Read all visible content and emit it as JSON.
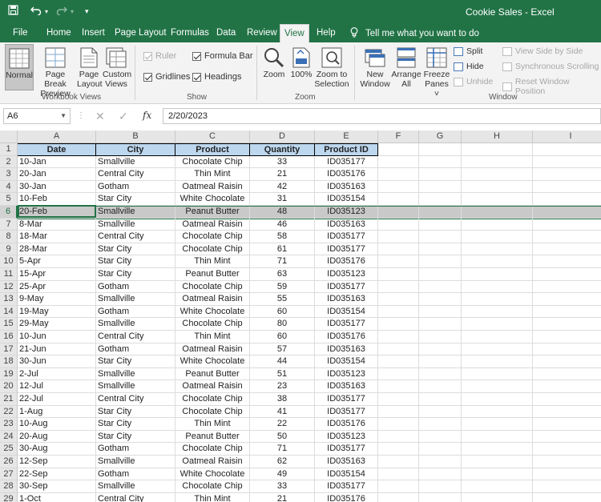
{
  "window": {
    "title": "Cookie Sales  -  Excel"
  },
  "tabs": [
    "File",
    "Home",
    "Insert",
    "Page Layout",
    "Formulas",
    "Data",
    "Review",
    "View",
    "Help"
  ],
  "active_tab": "View",
  "tell_me": "Tell me what you want to do",
  "ribbon": {
    "workbook_views": {
      "label": "Workbook Views",
      "normal": "Normal",
      "page_break_1": "Page Break",
      "page_break_2": "Preview",
      "page_layout_1": "Page",
      "page_layout_2": "Layout",
      "custom_1": "Custom",
      "custom_2": "Views"
    },
    "show": {
      "label": "Show",
      "ruler": "Ruler",
      "formula_bar": "Formula Bar",
      "gridlines": "Gridlines",
      "headings": "Headings"
    },
    "zoom": {
      "label": "Zoom",
      "zoom": "Zoom",
      "hundred": "100%",
      "zoom_sel_1": "Zoom to",
      "zoom_sel_2": "Selection"
    },
    "window": {
      "label": "Window",
      "new_1": "New",
      "new_2": "Window",
      "arrange_1": "Arrange",
      "arrange_2": "All",
      "freeze_1": "Freeze",
      "freeze_2": "Panes ˅",
      "split": "Split",
      "hide": "Hide",
      "unhide": "Unhide",
      "side_by_side": "View Side by Side",
      "sync_scroll": "Synchronous Scrolling",
      "reset_pos": "Reset Window Position"
    }
  },
  "formula_bar": {
    "name_box": "A6",
    "fx": "fx",
    "value": "2/20/2023"
  },
  "columns": [
    "A",
    "B",
    "C",
    "D",
    "E",
    "F",
    "G",
    "H",
    "I"
  ],
  "headers": [
    "Date",
    "City",
    "Product",
    "Quantity",
    "Product ID"
  ],
  "rows": [
    [
      "10-Jan",
      "Smallville",
      "Chocolate Chip",
      "33",
      "ID035177"
    ],
    [
      "20-Jan",
      "Central City",
      "Thin Mint",
      "21",
      "ID035176"
    ],
    [
      "30-Jan",
      "Gotham",
      "Oatmeal Raisin",
      "42",
      "ID035163"
    ],
    [
      "10-Feb",
      "Star City",
      "White Chocolate",
      "31",
      "ID035154"
    ],
    [
      "20-Feb",
      "Smallville",
      "Peanut Butter",
      "48",
      "ID035123"
    ],
    [
      "8-Mar",
      "Smallville",
      "Oatmeal Raisin",
      "46",
      "ID035163"
    ],
    [
      "18-Mar",
      "Central City",
      "Chocolate Chip",
      "58",
      "ID035177"
    ],
    [
      "28-Mar",
      "Star City",
      "Chocolate Chip",
      "61",
      "ID035177"
    ],
    [
      "5-Apr",
      "Star City",
      "Thin Mint",
      "71",
      "ID035176"
    ],
    [
      "15-Apr",
      "Star City",
      "Peanut Butter",
      "63",
      "ID035123"
    ],
    [
      "25-Apr",
      "Gotham",
      "Chocolate Chip",
      "59",
      "ID035177"
    ],
    [
      "9-May",
      "Smallville",
      "Oatmeal Raisin",
      "55",
      "ID035163"
    ],
    [
      "19-May",
      "Gotham",
      "White Chocolate",
      "60",
      "ID035154"
    ],
    [
      "29-May",
      "Smallville",
      "Chocolate Chip",
      "80",
      "ID035177"
    ],
    [
      "10-Jun",
      "Central City",
      "Thin Mint",
      "60",
      "ID035176"
    ],
    [
      "21-Jun",
      "Gotham",
      "Oatmeal Raisin",
      "57",
      "ID035163"
    ],
    [
      "30-Jun",
      "Star City",
      "White Chocolate",
      "44",
      "ID035154"
    ],
    [
      "2-Jul",
      "Smallville",
      "Peanut Butter",
      "51",
      "ID035123"
    ],
    [
      "12-Jul",
      "Smallville",
      "Oatmeal Raisin",
      "23",
      "ID035163"
    ],
    [
      "22-Jul",
      "Central City",
      "Chocolate Chip",
      "38",
      "ID035177"
    ],
    [
      "1-Aug",
      "Star City",
      "Chocolate Chip",
      "41",
      "ID035177"
    ],
    [
      "10-Aug",
      "Star City",
      "Thin Mint",
      "22",
      "ID035176"
    ],
    [
      "20-Aug",
      "Star City",
      "Peanut Butter",
      "50",
      "ID035123"
    ],
    [
      "30-Aug",
      "Gotham",
      "Chocolate Chip",
      "71",
      "ID035177"
    ],
    [
      "12-Sep",
      "Smallville",
      "Oatmeal Raisin",
      "62",
      "ID035163"
    ],
    [
      "22-Sep",
      "Gotham",
      "White Chocolate",
      "49",
      "ID035154"
    ],
    [
      "30-Sep",
      "Smallville",
      "Chocolate Chip",
      "33",
      "ID035177"
    ],
    [
      "1-Oct",
      "Central City",
      "Thin Mint",
      "21",
      "ID035176"
    ]
  ],
  "selected_row_index": 4,
  "colors": {
    "accent": "#217346",
    "header_fill": "#bdd7ee"
  }
}
